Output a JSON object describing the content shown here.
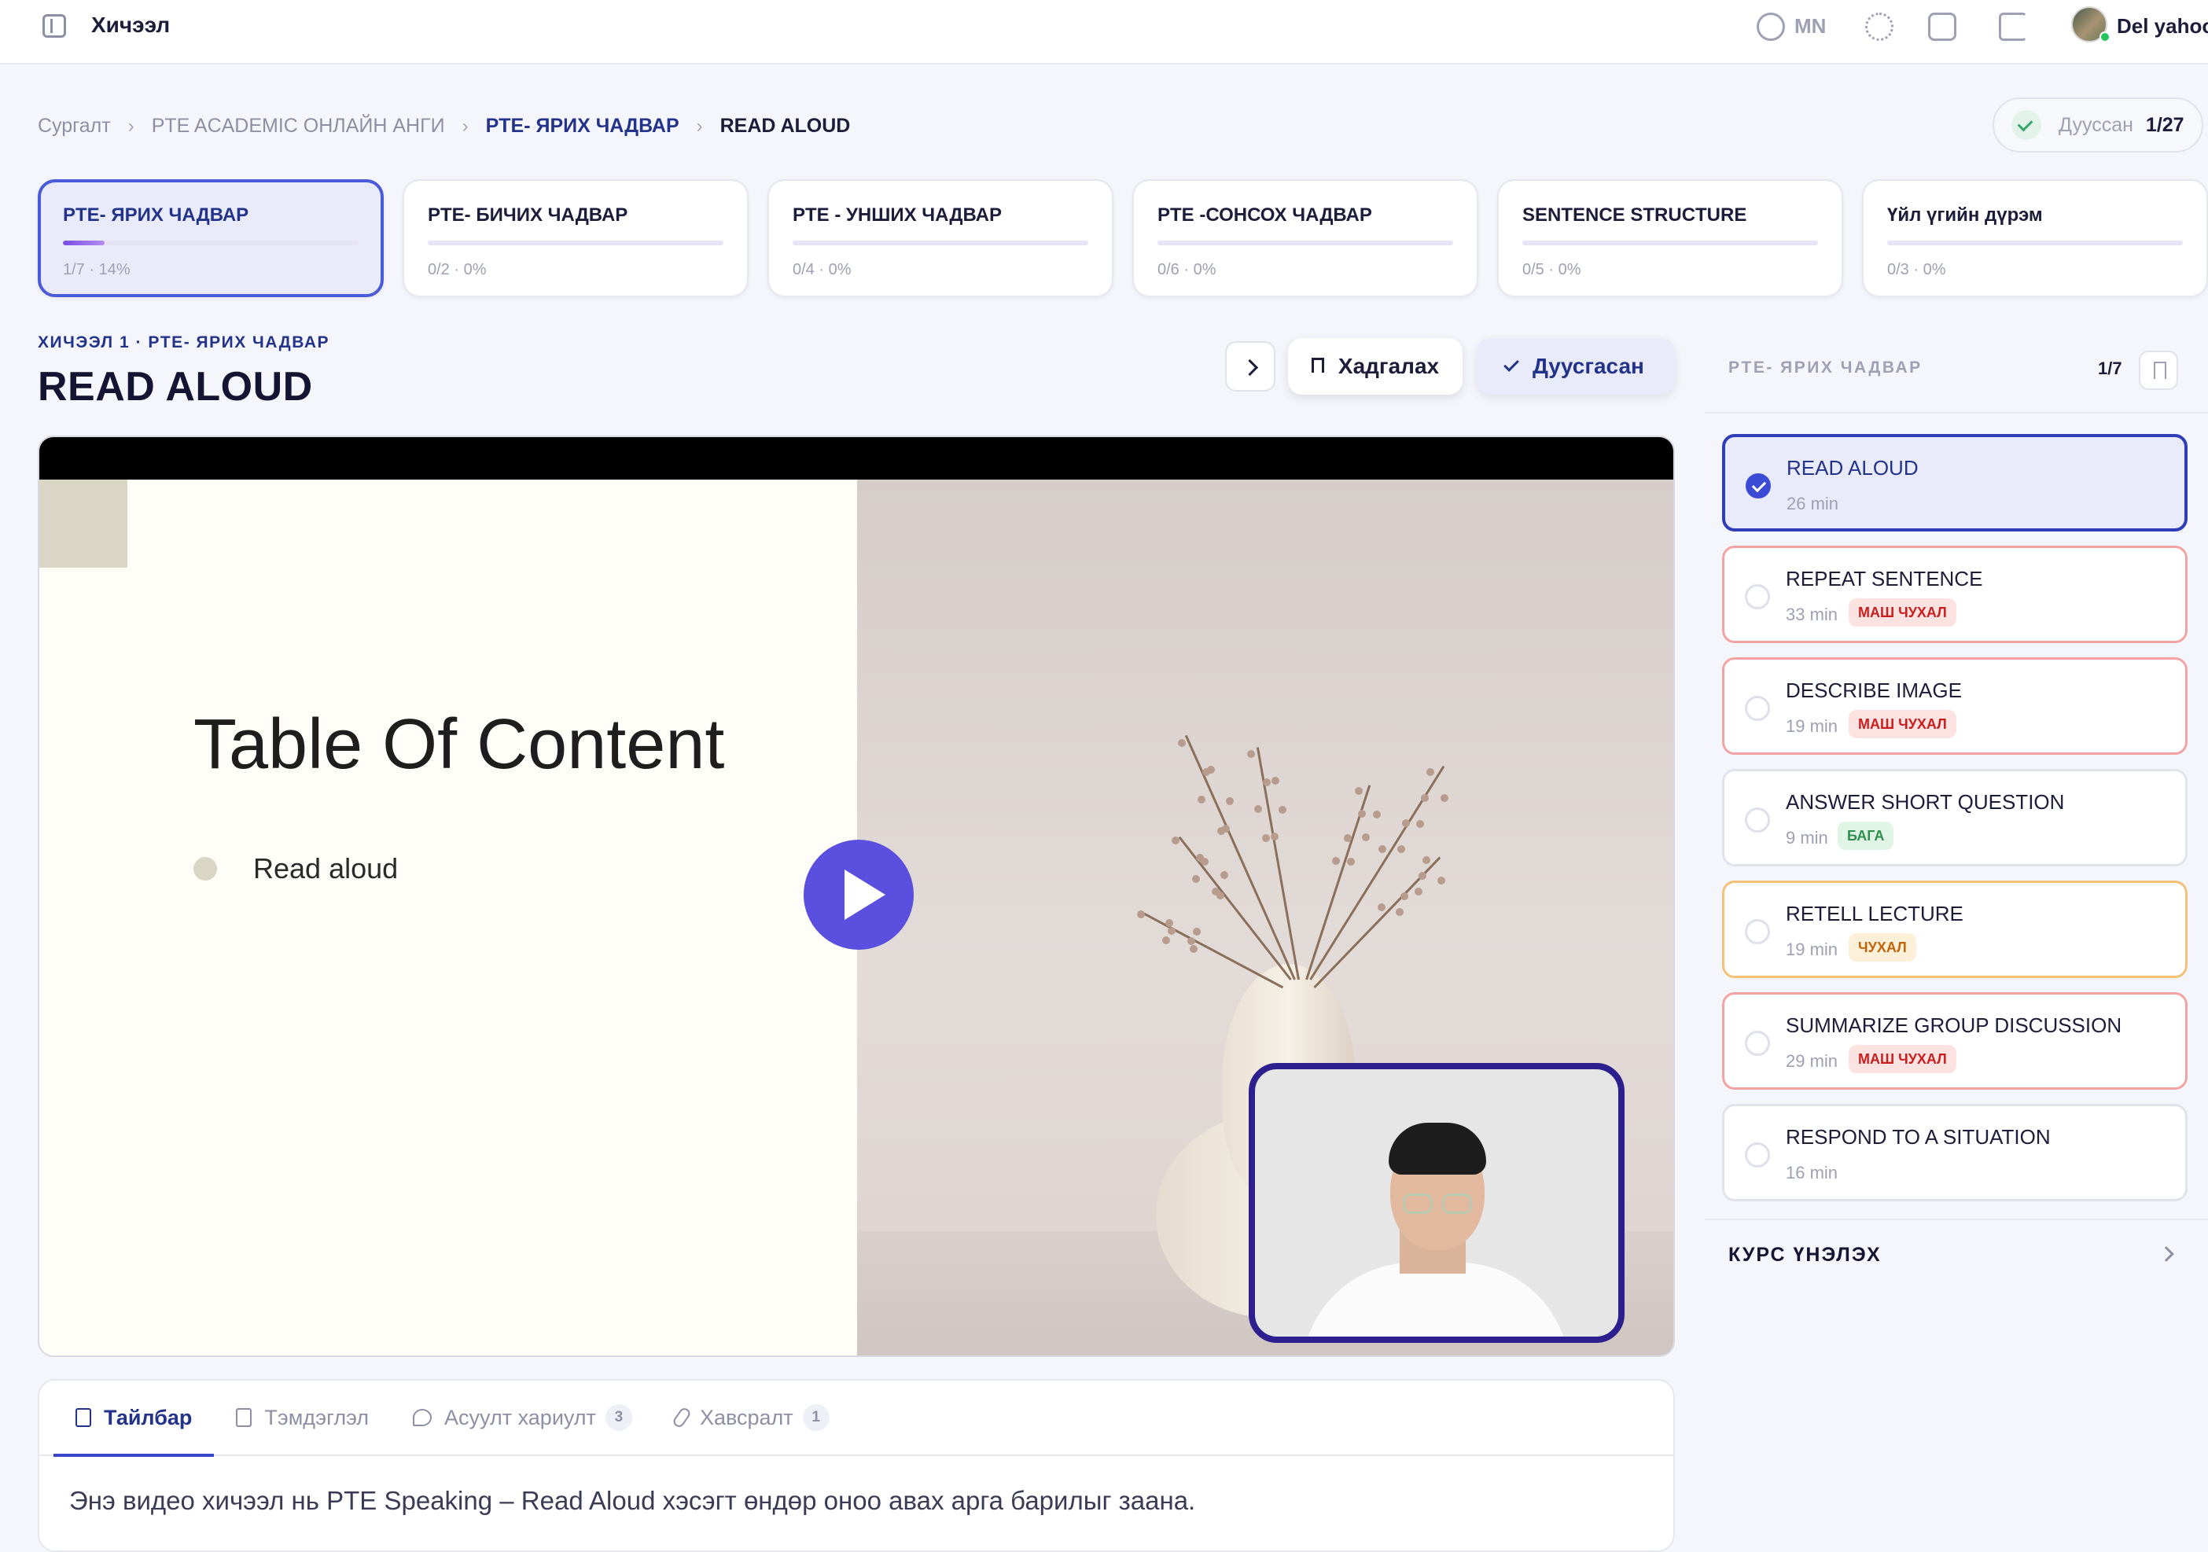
{
  "topbar": {
    "title": "Хичээл",
    "language": "MN",
    "user_name": "Del yahoo"
  },
  "breadcrumb": [
    "Сургалт",
    "PTE ACADEMIC ОНЛАЙН АНГИ",
    "PTE- ЯРИХ ЧАДВАР",
    "READ ALOUD"
  ],
  "progress": {
    "label": "Дуусcан",
    "value": "1/27"
  },
  "modules": [
    {
      "name": "PTE- ЯРИХ ЧАДВАР",
      "meta": "1/7 · 14%",
      "progress": 14,
      "active": true
    },
    {
      "name": "PTE- БИЧИХ ЧАДВАР",
      "meta": "0/2 · 0%",
      "progress": 0,
      "active": false
    },
    {
      "name": "PTE - УНШИХ ЧАДВАР",
      "meta": "0/4 · 0%",
      "progress": 0,
      "active": false
    },
    {
      "name": "PTE -СОНСОХ ЧАДВАР",
      "meta": "0/6 · 0%",
      "progress": 0,
      "active": false
    },
    {
      "name": "SENTENCE STRUCTURE",
      "meta": "0/5 · 0%",
      "progress": 0,
      "active": false
    },
    {
      "name": "Үйл үгийн дүрэм",
      "meta": "0/3 · 0%",
      "progress": 0,
      "active": false
    }
  ],
  "lesson": {
    "kicker": "ХИЧЭЭЛ 1 · PTE- ЯРИХ ЧАДВАР",
    "title": "READ ALOUD",
    "save_label": "Хадгалах",
    "done_label": "Дуусгасан"
  },
  "video": {
    "slide_title": "Table Of Content",
    "slide_item": "Read aloud"
  },
  "tabs": [
    {
      "label": "Тайлбар",
      "badge": "",
      "icon": "document-icon",
      "active": true
    },
    {
      "label": "Тэмдэглэл",
      "badge": "",
      "icon": "note-icon",
      "active": false
    },
    {
      "label": "Асуулт хариулт",
      "badge": "3",
      "icon": "chat-icon",
      "active": false
    },
    {
      "label": "Хавсралт",
      "badge": "1",
      "icon": "paperclip-icon",
      "active": false
    }
  ],
  "description": "Энэ видео хичээл нь PTE Speaking – Read Aloud хэсэгт өндөр оноо авах арга барилыг заана.",
  "sidebar": {
    "heading": "PTE- ЯРИХ ЧАДВАР",
    "count": "1/7",
    "lessons": [
      {
        "name": "READ ALOUD",
        "minutes": "26 min",
        "tag": "",
        "style": "active"
      },
      {
        "name": "REPEAT SENTENCE",
        "minutes": "33 min",
        "tag": "МАШ ЧУХАЛ",
        "style": "red"
      },
      {
        "name": "DESCRIBE IMAGE",
        "minutes": "19 min",
        "tag": "МАШ ЧУХАЛ",
        "style": "red"
      },
      {
        "name": "ANSWER SHORT QUESTION",
        "minutes": "9 min",
        "tag": "БАГА",
        "style": "green"
      },
      {
        "name": "RETELL LECTURE",
        "minutes": "19 min",
        "tag": "ЧУХАЛ",
        "style": "orange"
      },
      {
        "name": "SUMMARIZE GROUP DISCUSSION",
        "minutes": "29 min",
        "tag": "МАШ ЧУХАЛ",
        "style": "red"
      },
      {
        "name": "RESPOND TO A SITUATION",
        "minutes": "16 min",
        "tag": "",
        "style": "plain"
      }
    ],
    "rate_label": "КУРС ҮНЭЛЭХ"
  },
  "colors": {
    "accent": "#23338a",
    "primary": "#4a5ad9",
    "play": "#5b4fe0",
    "danger": "#c81e1e",
    "warning": "#c2650a",
    "success": "#2f8f4e"
  }
}
